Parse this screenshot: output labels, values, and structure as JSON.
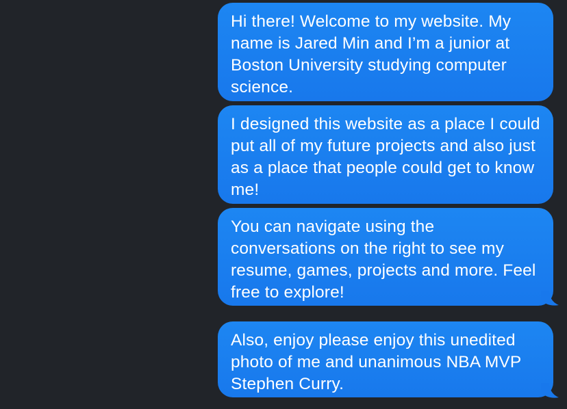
{
  "conversation": {
    "bubble_color": "#1a7ff0",
    "background_color": "#212429",
    "messages": [
      {
        "text": "Hi there! Welcome to my website. My name is Jared Min and I’m a junior at Boston University studying computer science."
      },
      {
        "text": "I designed this website as a place I could put all of my future projects and also just as a place that people could get to know me!"
      },
      {
        "text": "You can navigate using the conversations on the right to see my resume, games, projects and more. Feel free to explore!"
      },
      {
        "text": "Also, enjoy please enjoy this unedited photo of me and unanimous NBA MVP Stephen Curry."
      }
    ]
  }
}
